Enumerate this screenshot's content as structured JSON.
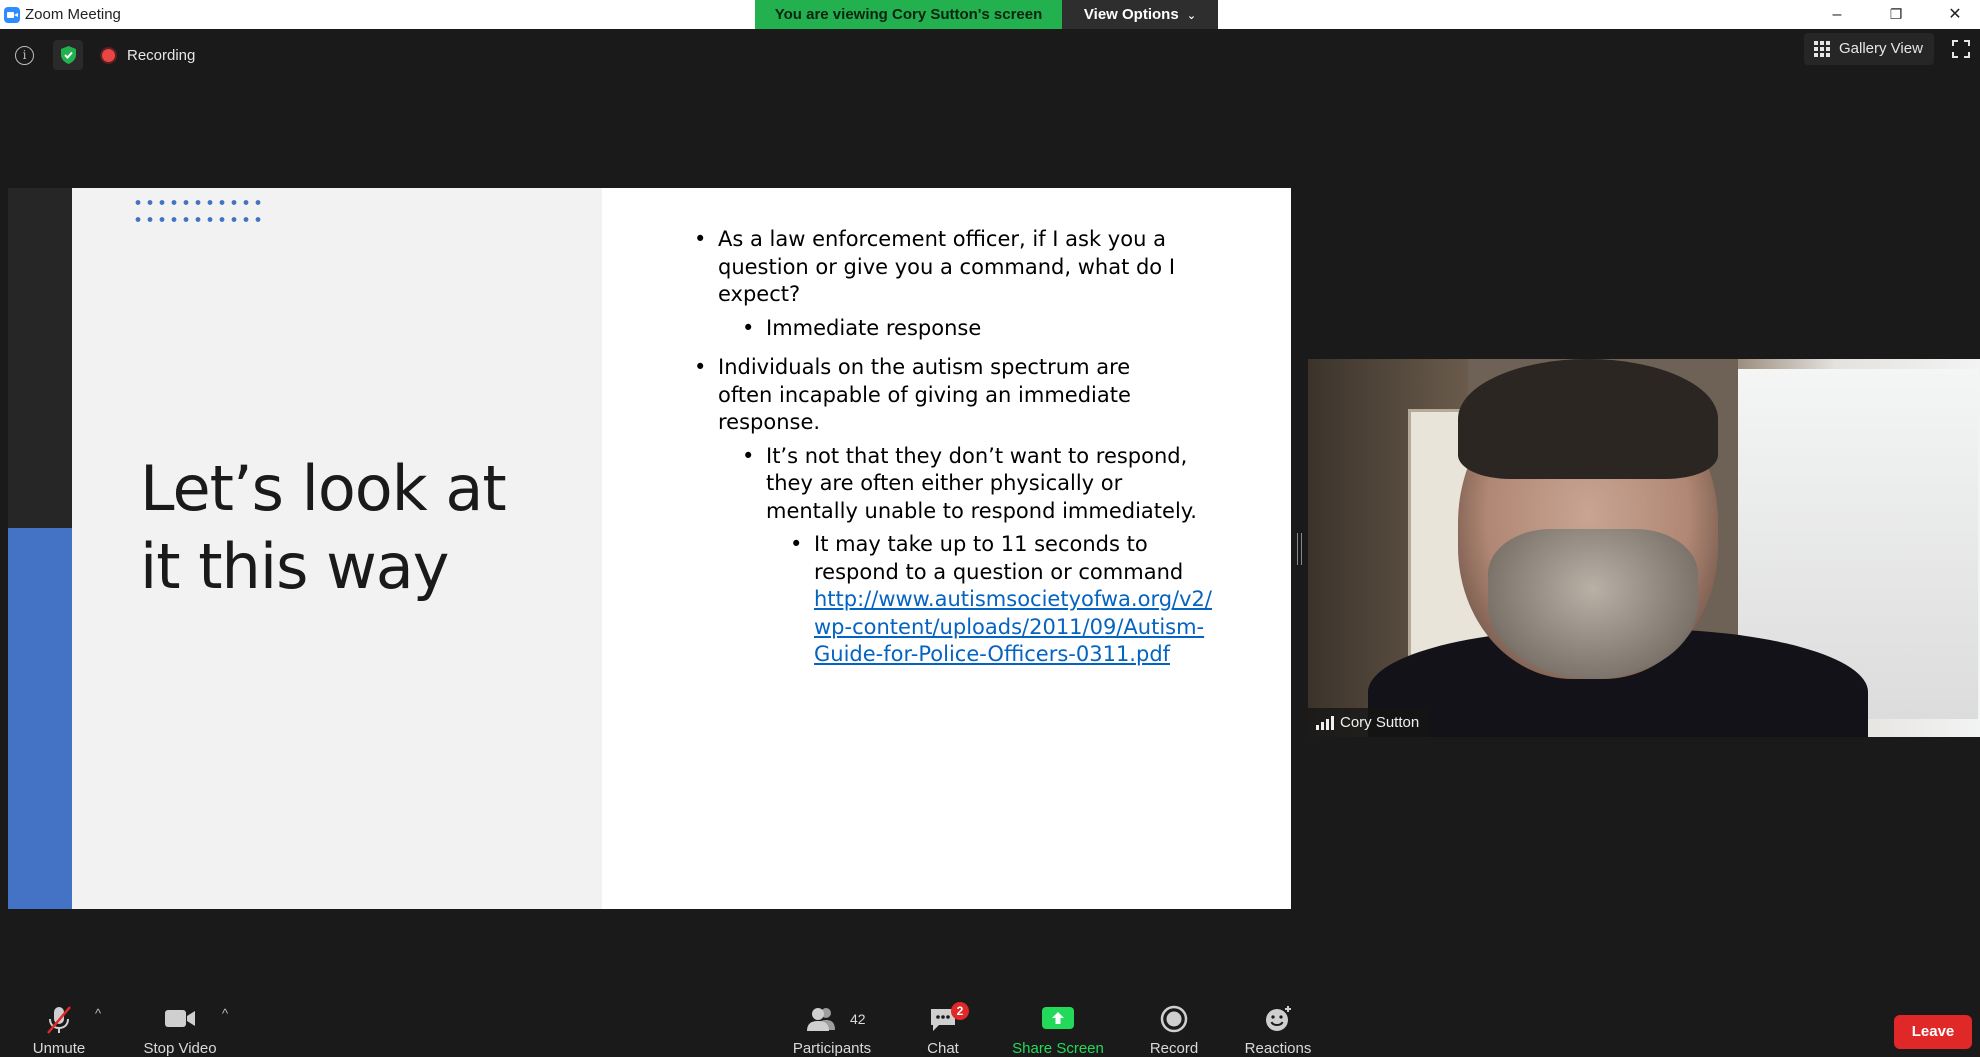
{
  "window": {
    "title": "Zoom Meeting",
    "banner": "You are viewing Cory Sutton's screen",
    "view_options": "View Options",
    "minimize": "–",
    "restore": "❐",
    "close": "✕"
  },
  "meeting_bar": {
    "info_glyph": "i",
    "recording_label": "Recording",
    "gallery_view_label": "Gallery View"
  },
  "slide": {
    "title_line1": "Let’s look at",
    "title_line2": "it this way",
    "bullets": {
      "b1": "As a law enforcement officer, if I ask you a question or give you a command, what do I expect?",
      "b1_1": "Immediate response",
      "b2": "Individuals on the autism spectrum are often incapable of giving an immediate response.",
      "b2_1": "It’s not that they don’t want to respond, they are often either physically or mentally unable to respond immediately.",
      "b2_1_1": "It may take up to 11 seconds to respond to a question or command",
      "b2_1_1_link": "http://www.autismsocietyofwa.org/v2/wp-content/uploads/2011/09/Autism-Guide-for-Police-Officers-0311.pdf"
    }
  },
  "video": {
    "participant_name": "Cory Sutton"
  },
  "toolbar": {
    "unmute_label": "Unmute",
    "stop_video_label": "Stop Video",
    "participants_label": "Participants",
    "participants_count": "42",
    "chat_label": "Chat",
    "chat_badge": "2",
    "share_screen_label": "Share Screen",
    "record_label": "Record",
    "reactions_label": "Reactions",
    "leave_label": "Leave",
    "caret": "^"
  },
  "colors": {
    "banner_green": "#23b04e",
    "share_green": "#23d959",
    "leave_red": "#e02828",
    "slide_blue": "#4472c4",
    "link_blue": "#0563c1"
  }
}
